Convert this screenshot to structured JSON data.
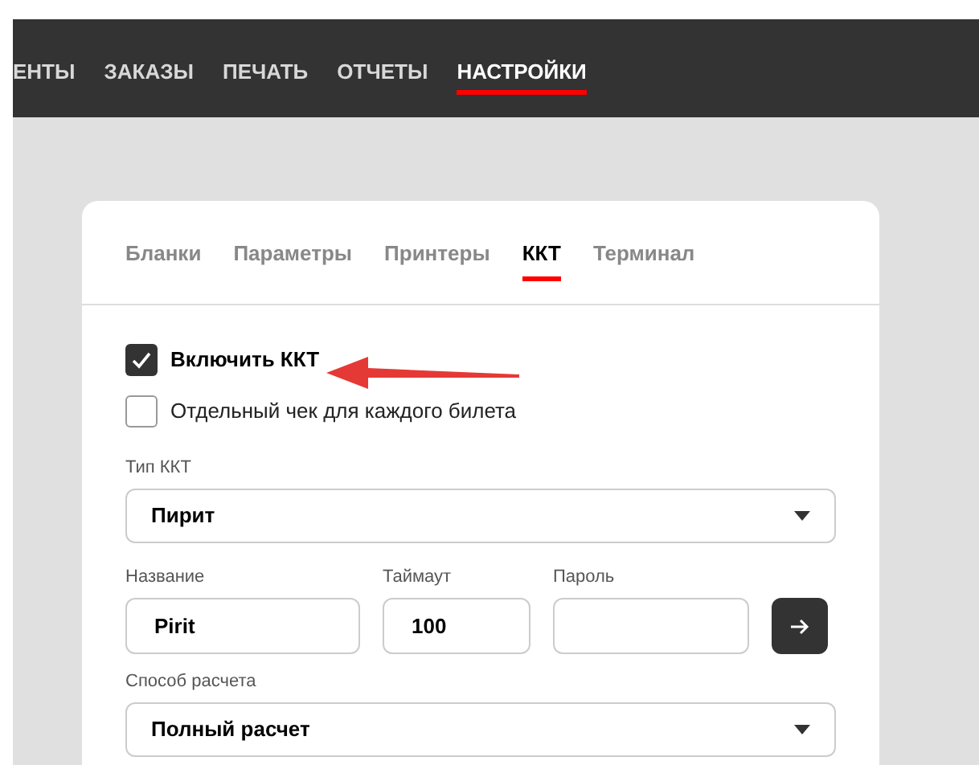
{
  "nav": [
    {
      "label": "ЕНТЫ",
      "selected": false
    },
    {
      "label": "ЗАКАЗЫ",
      "selected": false
    },
    {
      "label": "ПЕЧАТЬ",
      "selected": false
    },
    {
      "label": "ОТЧЕТЫ",
      "selected": false
    },
    {
      "label": "НАСТРОЙКИ",
      "selected": true
    }
  ],
  "tabs": [
    {
      "label": "Бланки",
      "selected": false
    },
    {
      "label": "Параметры",
      "selected": false
    },
    {
      "label": "Принтеры",
      "selected": false
    },
    {
      "label": "ККТ",
      "selected": true
    },
    {
      "label": "Терминал",
      "selected": false
    }
  ],
  "options": [
    {
      "label": "Включить ККТ",
      "checked": true
    },
    {
      "label": "Отдельный чек для каждого билета",
      "checked": false
    }
  ],
  "kkt_type": {
    "label": "Тип ККТ",
    "value": "Пирит"
  },
  "connection": [
    {
      "label": "Название",
      "value": "Pirit"
    },
    {
      "label": "Таймаут",
      "value": "100"
    },
    {
      "label": "Пароль"
    }
  ],
  "payment_method": {
    "label": "Способ расчета",
    "value": "Полный расчет"
  }
}
